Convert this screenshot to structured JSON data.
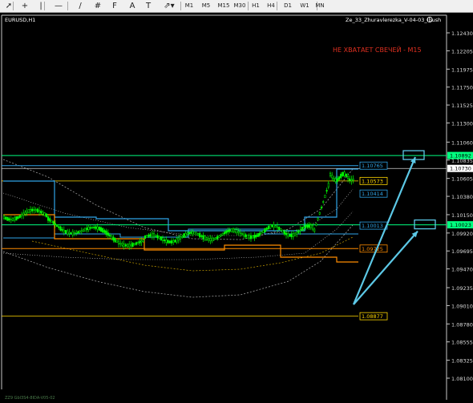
{
  "toolbar": {
    "tools": [
      {
        "icon": "cursor-arrow-icon",
        "glyph": "➚"
      },
      {
        "icon": "crosshair-icon",
        "glyph": "+"
      },
      {
        "icon": "vertical-line-icon",
        "glyph": "|"
      },
      {
        "icon": "horizontal-line-icon",
        "glyph": "—"
      },
      {
        "icon": "trendline-icon",
        "glyph": "/"
      },
      {
        "icon": "equidistant-channel-icon",
        "glyph": "#"
      },
      {
        "icon": "fibonacci-icon",
        "glyph": "F"
      },
      {
        "icon": "text-label-icon",
        "glyph": "A"
      },
      {
        "icon": "text-field-icon",
        "glyph": "T"
      },
      {
        "icon": "arrows-dropdown-icon",
        "glyph": "⇗▾"
      }
    ],
    "timeframes": [
      "M1",
      "M5",
      "M15",
      "M30",
      "H1",
      "H4",
      "D1",
      "W1",
      "MN"
    ]
  },
  "chart": {
    "symbol": "EURUSD,H1",
    "indicator": "Ze_33_Zhuravlerezka_V-04-03_Ibush",
    "indicator_icon": "smiley-face-icon",
    "warning": "НЕ ХВАТАЕТ СВЕЧЕЙ - M15",
    "footer": "ZZ9 Gbl3S4-8IDA-V05-02",
    "price_scale": [
      "1.12430",
      "1.12205",
      "1.11975",
      "1.11750",
      "1.11525",
      "1.11300",
      "1.11060",
      "1.10835",
      "1.10605",
      "1.10380",
      "1.10150",
      "1.09920",
      "1.09695",
      "1.09470",
      "1.09235",
      "1.09010",
      "1.08780",
      "1.08555",
      "1.08325",
      "1.08100"
    ],
    "current_price": "1.10730",
    "level_labels": [
      {
        "text": "1.10892",
        "price": 1.10892,
        "color": "#00ff7f",
        "scale": true
      },
      {
        "text": "1.10765",
        "price": 1.10765,
        "color": "#2fa4e7",
        "scale": false
      },
      {
        "text": "1.10573",
        "price": 1.10573,
        "color": "#ffd700",
        "scale": false
      },
      {
        "text": "1.10414",
        "price": 1.10414,
        "color": "#2fa4e7",
        "scale": false
      },
      {
        "text": "1.10023",
        "price": 1.10023,
        "color": "#00ff7f",
        "scale": true
      },
      {
        "text": "1.10013",
        "price": 1.10013,
        "color": "#2fa4e7",
        "scale": false
      },
      {
        "text": "1.09725",
        "price": 1.09725,
        "color": "#ff8c00",
        "scale": false
      },
      {
        "text": "1.08877",
        "price": 1.08877,
        "color": "#ffd700",
        "scale": false
      }
    ],
    "colors": {
      "candles": "#00ff00",
      "support_resistance": "#00ff7f",
      "blue_levels": "#2fa4e7",
      "orange_levels": "#ff8c00",
      "yellow_levels": "#ffd700",
      "warning_text": "#e03020",
      "arrows": "#5cc8e6"
    }
  }
}
